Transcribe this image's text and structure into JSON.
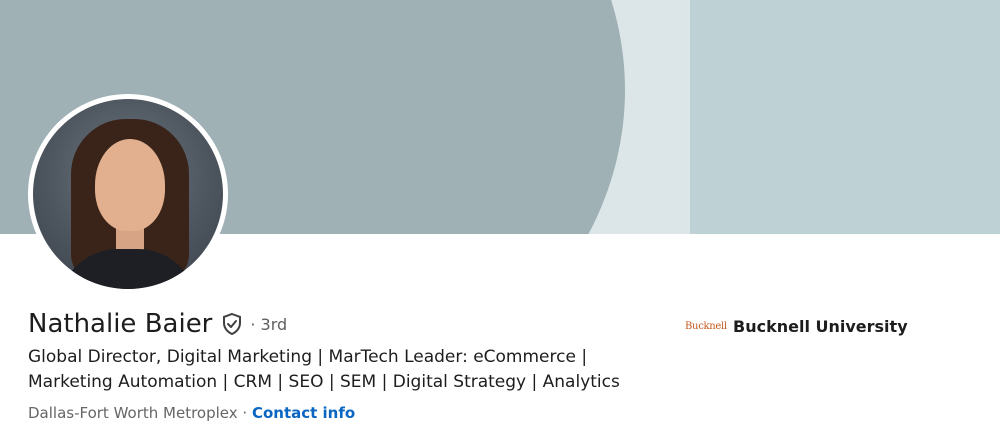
{
  "profile": {
    "name": "Nathalie Baier",
    "degree": "· 3rd",
    "headline": "Global Director, Digital Marketing | MarTech Leader: eCommerce | Marketing Automation | CRM | SEO | SEM | Digital Strategy | Analytics",
    "location": "Dallas-Fort Worth Metroplex",
    "separator": " · ",
    "contact_label": "Contact info",
    "verified_icon": "shield-check-icon"
  },
  "education": {
    "logo_text": "Bucknell",
    "school": "Bucknell University"
  },
  "colors": {
    "link": "#0a66c2",
    "cover_dark": "#9fb1b5",
    "cover_light": "#dce6e9",
    "cover_right": "#bed2d6"
  }
}
